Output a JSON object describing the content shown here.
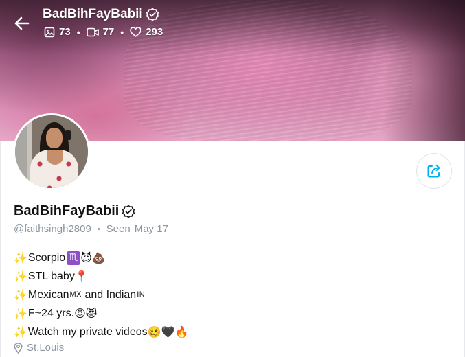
{
  "header": {
    "display_name": "BadBihFayBabii",
    "stats": {
      "photos": "73",
      "videos": "77",
      "likes": "293"
    }
  },
  "profile": {
    "display_name": "BadBihFayBabii",
    "handle": "@faithsingh2809",
    "seen_label": "Seen",
    "seen_date": "May 17",
    "location": "St.Louis"
  },
  "bio": {
    "line1": {
      "text": "Scorpio",
      "zodiac": "♏",
      "emojis": "😈💩"
    },
    "line2": {
      "text": "STL baby",
      "emojis": "📍"
    },
    "line3": {
      "text_a": "Mexican",
      "tag_a": "MX",
      "text_b": " and Indian",
      "tag_b": "IN"
    },
    "line4": {
      "text": "F~24 yrs.",
      "emojis": "😡😻"
    },
    "line5": {
      "text": "Watch my private videos",
      "emojis": "🥴🖤🔥"
    },
    "sparkle": "✨"
  },
  "colors": {
    "accent": "#00aff0",
    "muted_text": "#8a96a3",
    "zodiac_bg": "#8e4fc7"
  },
  "icons": {
    "back": "arrow-left-icon",
    "verified": "verified-badge-icon",
    "photos": "image-icon",
    "videos": "video-camera-icon",
    "likes": "heart-icon",
    "share": "share-icon",
    "location": "map-pin-icon"
  }
}
